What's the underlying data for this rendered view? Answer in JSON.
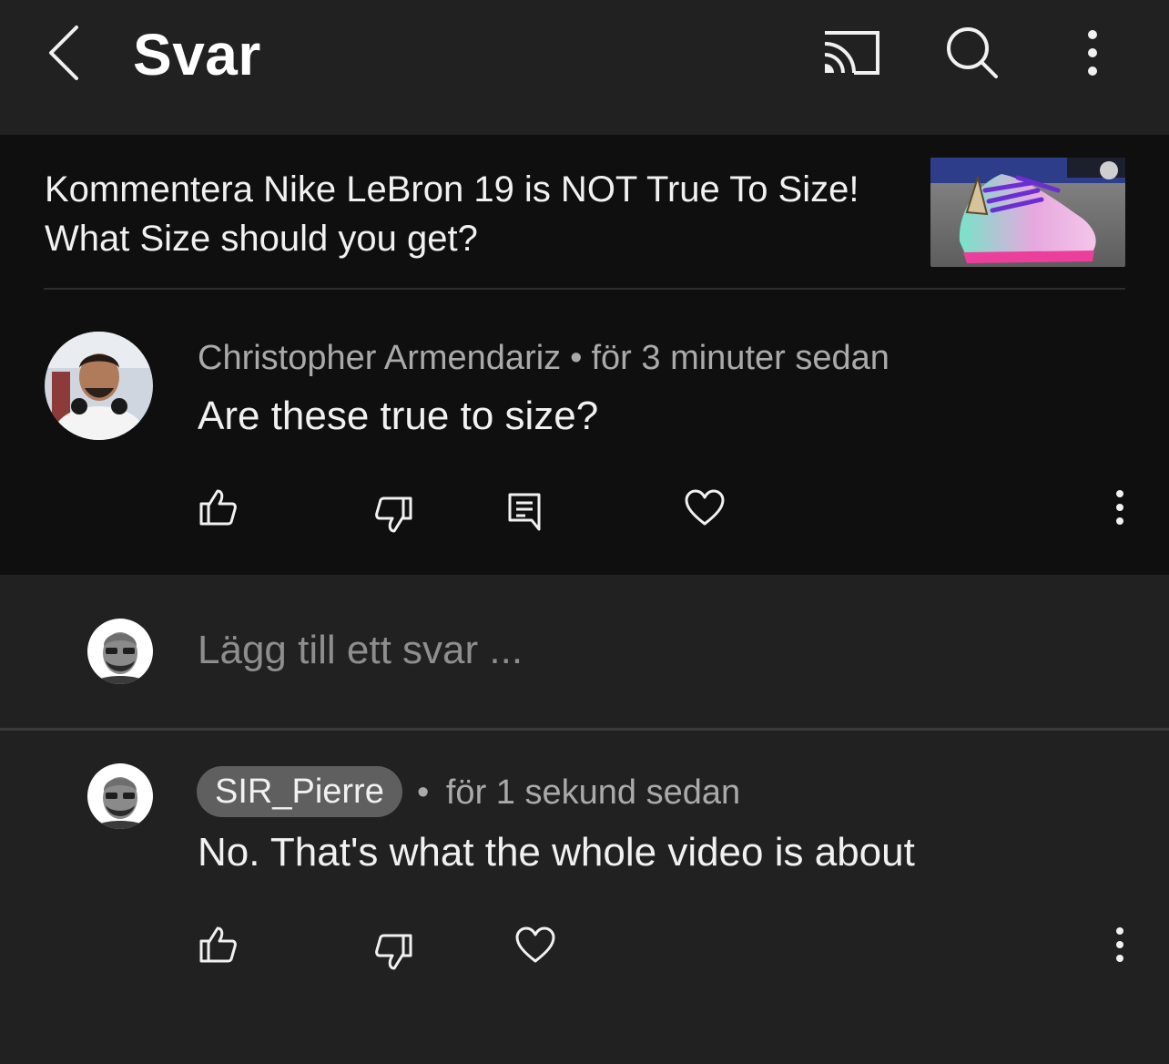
{
  "header": {
    "title": "Svar",
    "icons": [
      "back-arrow-icon",
      "cast-icon",
      "search-icon",
      "more-vertical-icon"
    ]
  },
  "video": {
    "title": "Kommentera Nike LeBron 19 is NOT True To Size! What Size should you get?"
  },
  "comment": {
    "author": "Christopher Armendariz",
    "separator": "•",
    "time": "för 3 minuter sedan",
    "text": "Are these true to size?",
    "actions": [
      "like-icon",
      "dislike-icon",
      "reply-icon",
      "heart-icon",
      "more-vertical-icon"
    ]
  },
  "reply_input": {
    "placeholder": "Lägg till ett svar ..."
  },
  "reply": {
    "author": "SIR_Pierre",
    "separator": "•",
    "time": "för 1 sekund sedan",
    "text": "No. That's what the whole video is about",
    "actions": [
      "like-icon",
      "dislike-icon",
      "heart-icon",
      "more-vertical-icon"
    ]
  },
  "colors": {
    "background": "#212121",
    "panel": "#0f0f0f",
    "secondary_text": "#aaaaaa",
    "chip": "#5f5f5f"
  }
}
